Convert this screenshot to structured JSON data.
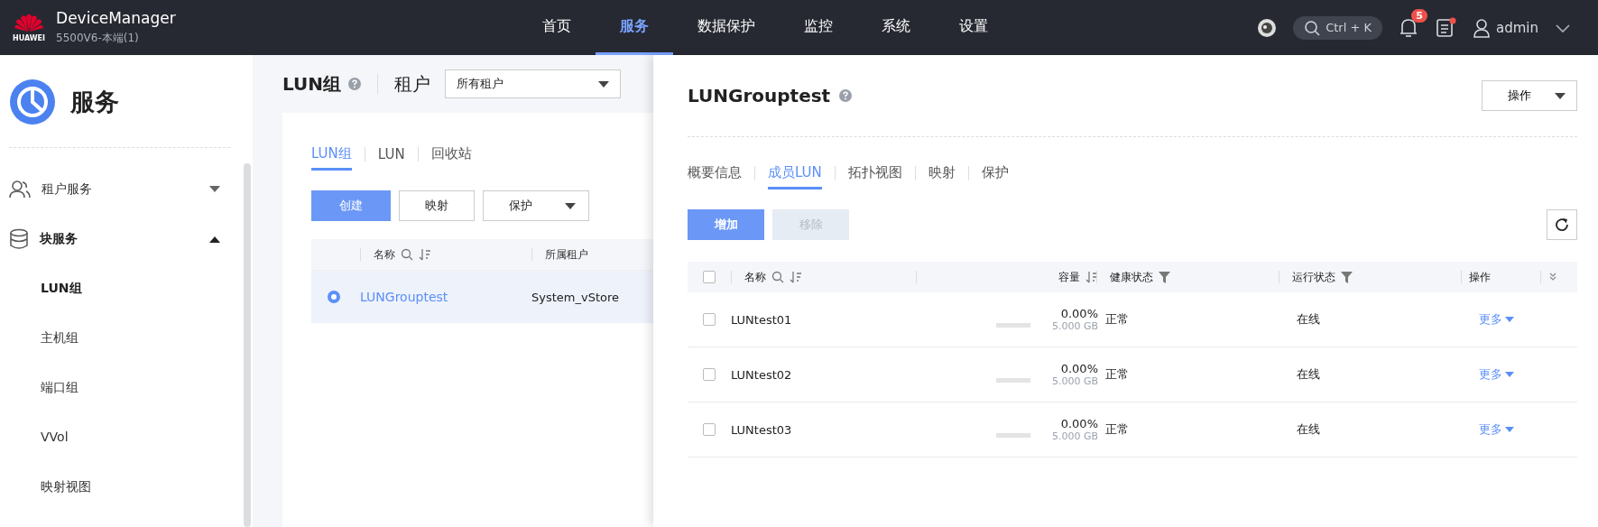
{
  "header": {
    "brand": "HUAWEI",
    "app_name": "DeviceManager",
    "device": "5500V6-本端(1)",
    "nav": [
      {
        "label": "首页",
        "selected": false
      },
      {
        "label": "服务",
        "selected": true
      },
      {
        "label": "数据保护",
        "selected": false
      },
      {
        "label": "监控",
        "selected": false
      },
      {
        "label": "系统",
        "selected": false
      },
      {
        "label": "设置",
        "selected": false
      }
    ],
    "search_hint": "Ctrl + K",
    "notification_count": "5",
    "user": "admin"
  },
  "sidebar": {
    "title": "服务",
    "items": [
      {
        "label": "租户服务",
        "expanded": false
      },
      {
        "label": "块服务",
        "expanded": true,
        "children": [
          {
            "label": "LUN组",
            "selected": true
          },
          {
            "label": "主机组",
            "selected": false
          },
          {
            "label": "端口组",
            "selected": false
          },
          {
            "label": "VVol",
            "selected": false
          },
          {
            "label": "映射视图",
            "selected": false
          }
        ]
      }
    ]
  },
  "main": {
    "title": "LUN组",
    "tenant_label": "租户",
    "tenant_select": "所有租户",
    "tabs": [
      {
        "label": "LUN组",
        "selected": true
      },
      {
        "label": "LUN",
        "selected": false
      },
      {
        "label": "回收站",
        "selected": false
      }
    ],
    "buttons": [
      {
        "label": "创建",
        "kind": "primary"
      },
      {
        "label": "映射",
        "kind": "default"
      },
      {
        "label": "保护",
        "kind": "dropdown"
      }
    ],
    "columns": [
      "名称",
      "所属租户"
    ],
    "rows": [
      {
        "selected": true,
        "name": "LUNGrouptest",
        "tenant": "System_vStore"
      }
    ]
  },
  "drawer": {
    "title": "LUNGrouptest",
    "action": "操作",
    "tabs": [
      {
        "label": "概要信息",
        "selected": false
      },
      {
        "label": "成员LUN",
        "selected": true
      },
      {
        "label": "拓扑视图",
        "selected": false
      },
      {
        "label": "映射",
        "selected": false
      },
      {
        "label": "保护",
        "selected": false
      }
    ],
    "buttons": [
      {
        "label": "增加",
        "disabled": false
      },
      {
        "label": "移除",
        "disabled": true
      }
    ],
    "select_all": false,
    "columns": {
      "name": "名称",
      "capacity": "容量",
      "health": "健康状态",
      "status": "运行状态",
      "action": "操作"
    },
    "rows": [
      {
        "checked": false,
        "name": "LUNtest01",
        "level": 0,
        "usage": "0.00%",
        "capacity": "5.000 GB",
        "health": "正常",
        "status": "在线",
        "action": "更多"
      },
      {
        "checked": false,
        "name": "LUNtest02",
        "level": 0,
        "usage": "0.00%",
        "capacity": "5.000 GB",
        "health": "正常",
        "status": "在线",
        "action": "更多"
      },
      {
        "checked": false,
        "name": "LUNtest03",
        "level": 0,
        "usage": "0.00%",
        "capacity": "5.000 GB",
        "health": "正常",
        "status": "在线",
        "action": "更多"
      }
    ]
  }
}
